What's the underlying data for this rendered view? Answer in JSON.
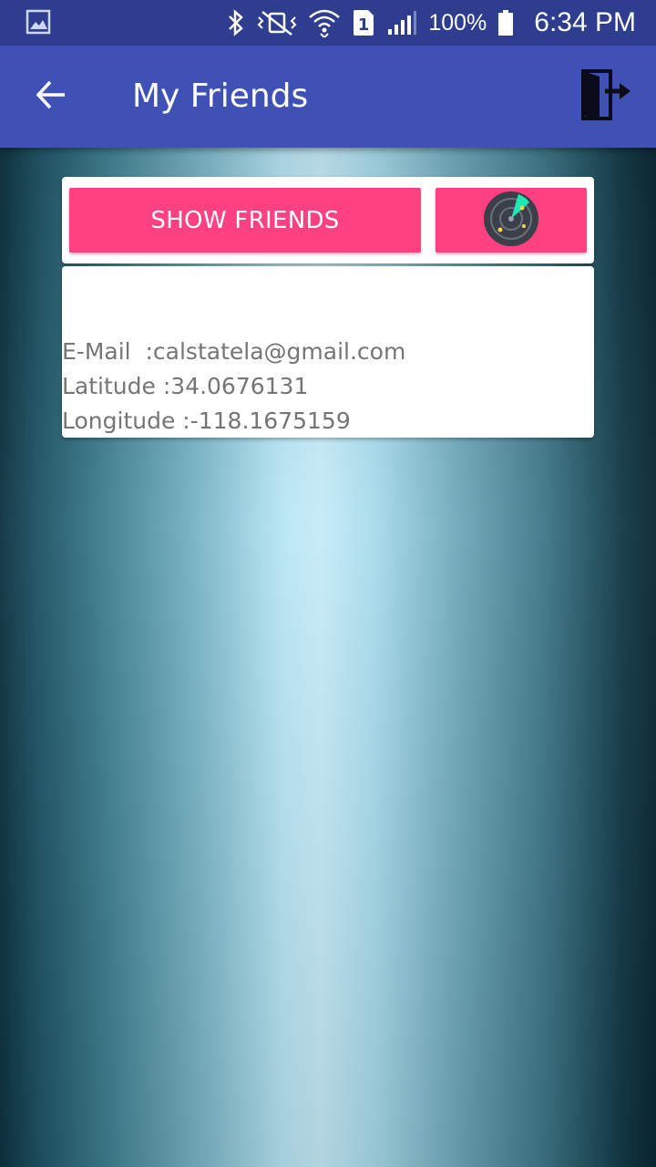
{
  "status_bar": {
    "battery": "100%",
    "time": "6:34 PM",
    "sim_slot": "1",
    "icons": [
      "gallery-icon",
      "bluetooth-icon",
      "vibrate-icon",
      "wifi-icon",
      "sim-icon",
      "signal-icon",
      "battery-icon"
    ]
  },
  "app_bar": {
    "title": "My Friends",
    "back_icon": "arrow-back-icon",
    "logout_icon": "logout-door-icon",
    "color": "#3f51b5"
  },
  "actions": {
    "show_friends_label": "SHOW FRIENDS",
    "radar_icon": "radar-icon",
    "accent": "#ff4081"
  },
  "info": {
    "email": "E-Mail  :calstatela@gmail.com",
    "latitude": "Latitude :34.0676131",
    "longitude": "Longitude :-118.1675159"
  }
}
